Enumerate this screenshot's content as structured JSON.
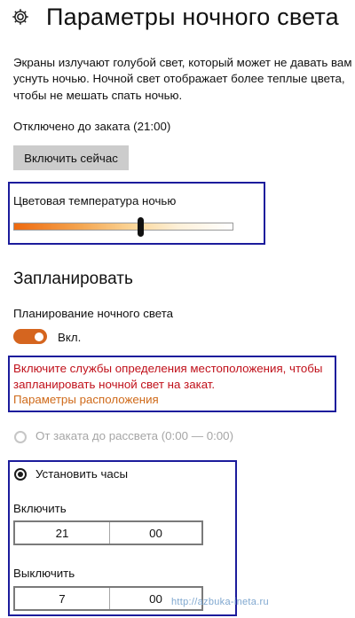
{
  "header": {
    "title": "Параметры ночного света",
    "icon": "gear-icon"
  },
  "description": {
    "line1": "Экраны излучают голубой свет, который может не давать вам",
    "line2": "уснуть ночью. Ночной свет отображает более теплые цвета,",
    "line3": "чтобы не мешать спать ночью."
  },
  "status_text": "Отключено до заката (21:00)",
  "enable_now_button": "Включить сейчас",
  "color_temperature": {
    "label": "Цветовая температура ночью",
    "level": 0.58,
    "gradient_colors": [
      "#ee6a10",
      "#f4a550",
      "#fbd79a",
      "#fdf0d8",
      "#ffffff"
    ]
  },
  "schedule": {
    "heading": "Запланировать",
    "toggle_label": "Планирование ночного света",
    "toggle_state": "Вкл.",
    "toggle_on": true,
    "toggle_color": "#d5651f"
  },
  "location_warning": {
    "line1": "Включите службы определения местоположения, чтобы",
    "line2": "запланировать ночной свет на закат.",
    "link": "Параметры расположения",
    "text_color": "#c0101a",
    "link_color": "#cf6a1a"
  },
  "radio_options": {
    "sunset": "От заката до рассвета (0:00 — 0:00)",
    "set_hours": "Установить часы",
    "selected": "set_hours"
  },
  "turn_on": {
    "label": "Включить",
    "hours": "21",
    "minutes": "00"
  },
  "turn_off": {
    "label": "Выключить",
    "hours": "7",
    "minutes": "00"
  },
  "watermark": "http://azbuka-ineta.ru",
  "highlight_color": "#1c1c9c"
}
